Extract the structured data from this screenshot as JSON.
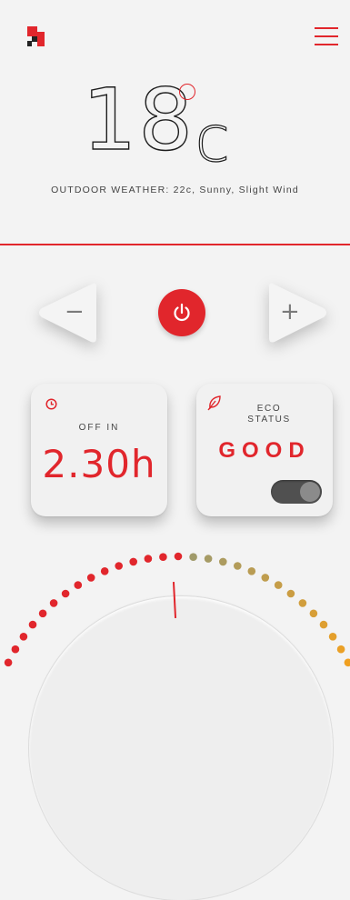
{
  "header": {
    "logo_icon": "brand-logo",
    "menu_icon": "hamburger-menu-icon"
  },
  "temperature": {
    "value": "18",
    "unit": "c"
  },
  "outdoor_weather": "OUTDOOR WEATHER: 22c, Sunny, Slight Wind",
  "controls": {
    "decrease_symbol": "−",
    "increase_symbol": "+",
    "power_icon": "power-icon"
  },
  "timer_card": {
    "icon": "clock-icon",
    "label": "OFF IN",
    "value": "2.30h"
  },
  "eco_card": {
    "icon": "leaf-icon",
    "label_line1": "ECO",
    "label_line2": "STATUS",
    "value": "GOOD",
    "toggle_on": true
  },
  "dial": {
    "level": 0.5
  },
  "colors": {
    "accent": "#e1262c",
    "background": "#f3f3f3",
    "dot_green": "#9a9a70",
    "dot_orange": "#f0a020"
  }
}
